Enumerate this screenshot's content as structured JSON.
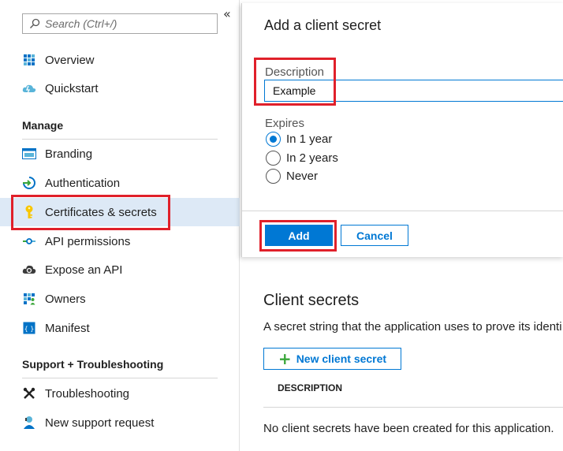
{
  "search": {
    "placeholder": "Search (Ctrl+/)"
  },
  "sidebar": {
    "collapse_glyph": "«",
    "top_items": [
      {
        "label": "Overview",
        "icon": "grid-icon"
      },
      {
        "label": "Quickstart",
        "icon": "cloud-icon"
      }
    ],
    "manage_header": "Manage",
    "manage_items": [
      {
        "label": "Branding",
        "icon": "branding-icon"
      },
      {
        "label": "Authentication",
        "icon": "authentication-icon"
      },
      {
        "label": "Certificates & secrets",
        "icon": "key-icon",
        "selected": true
      },
      {
        "label": "API permissions",
        "icon": "api-permissions-icon"
      },
      {
        "label": "Expose an API",
        "icon": "cloud-gear-icon"
      },
      {
        "label": "Owners",
        "icon": "owners-icon"
      },
      {
        "label": "Manifest",
        "icon": "manifest-icon"
      }
    ],
    "support_header": "Support + Troubleshooting",
    "support_items": [
      {
        "label": "Troubleshooting",
        "icon": "wrench-icon"
      },
      {
        "label": "New support request",
        "icon": "support-person-icon"
      }
    ]
  },
  "dialog": {
    "title": "Add a client secret",
    "description_label": "Description",
    "description_value": "Example",
    "expires_label": "Expires",
    "expires_options": [
      "In 1 year",
      "In 2 years",
      "Never"
    ],
    "expires_selected": "In 1 year",
    "add_label": "Add",
    "cancel_label": "Cancel"
  },
  "client_secrets": {
    "title": "Client secrets",
    "description": "A secret string that the application uses to prove its identi",
    "new_button_label": "New client secret",
    "new_button_glyph": "+",
    "column_header": "DESCRIPTION",
    "empty_message": "No client secrets have been created for this application."
  },
  "colors": {
    "accent": "#0078d4",
    "highlight": "#e0202a",
    "selected_bg": "#dde9f6"
  }
}
